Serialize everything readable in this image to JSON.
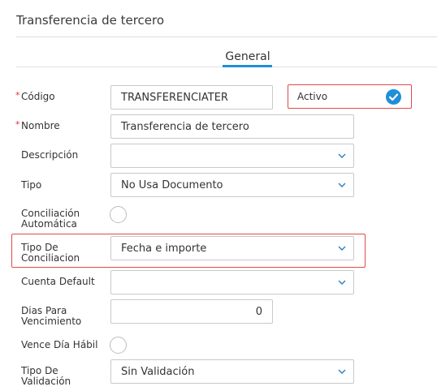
{
  "header": {
    "title": "Transferencia de tercero"
  },
  "tabs": [
    {
      "label": "General"
    }
  ],
  "form": {
    "codigo": {
      "label": "Código",
      "value": "TRANSFERENCIATER"
    },
    "activo": {
      "label": "Activo",
      "checked": true
    },
    "nombre": {
      "label": "Nombre",
      "value": "Transferencia de tercero"
    },
    "descripcion": {
      "label": "Descripción",
      "value": ""
    },
    "tipo": {
      "label": "Tipo",
      "value": "No Usa Documento"
    },
    "conciliacion_automatica": {
      "label": "Conciliación Automática",
      "checked": false
    },
    "tipo_de_conciliacion": {
      "label": "Tipo De Conciliacion",
      "value": "Fecha e importe"
    },
    "cuenta_default": {
      "label": "Cuenta Default",
      "value": ""
    },
    "dias_para_vencimiento": {
      "label": "Dias Para Vencimiento",
      "value": "0"
    },
    "vence_dia_habil": {
      "label": "Vence Día Hábil",
      "checked": false
    },
    "tipo_de_validacion": {
      "label": "Tipo De Validación",
      "value": "Sin Validación"
    }
  },
  "colors": {
    "accent": "#1f8fd6",
    "highlight": "#e04a4a",
    "required": "#d9363e"
  }
}
